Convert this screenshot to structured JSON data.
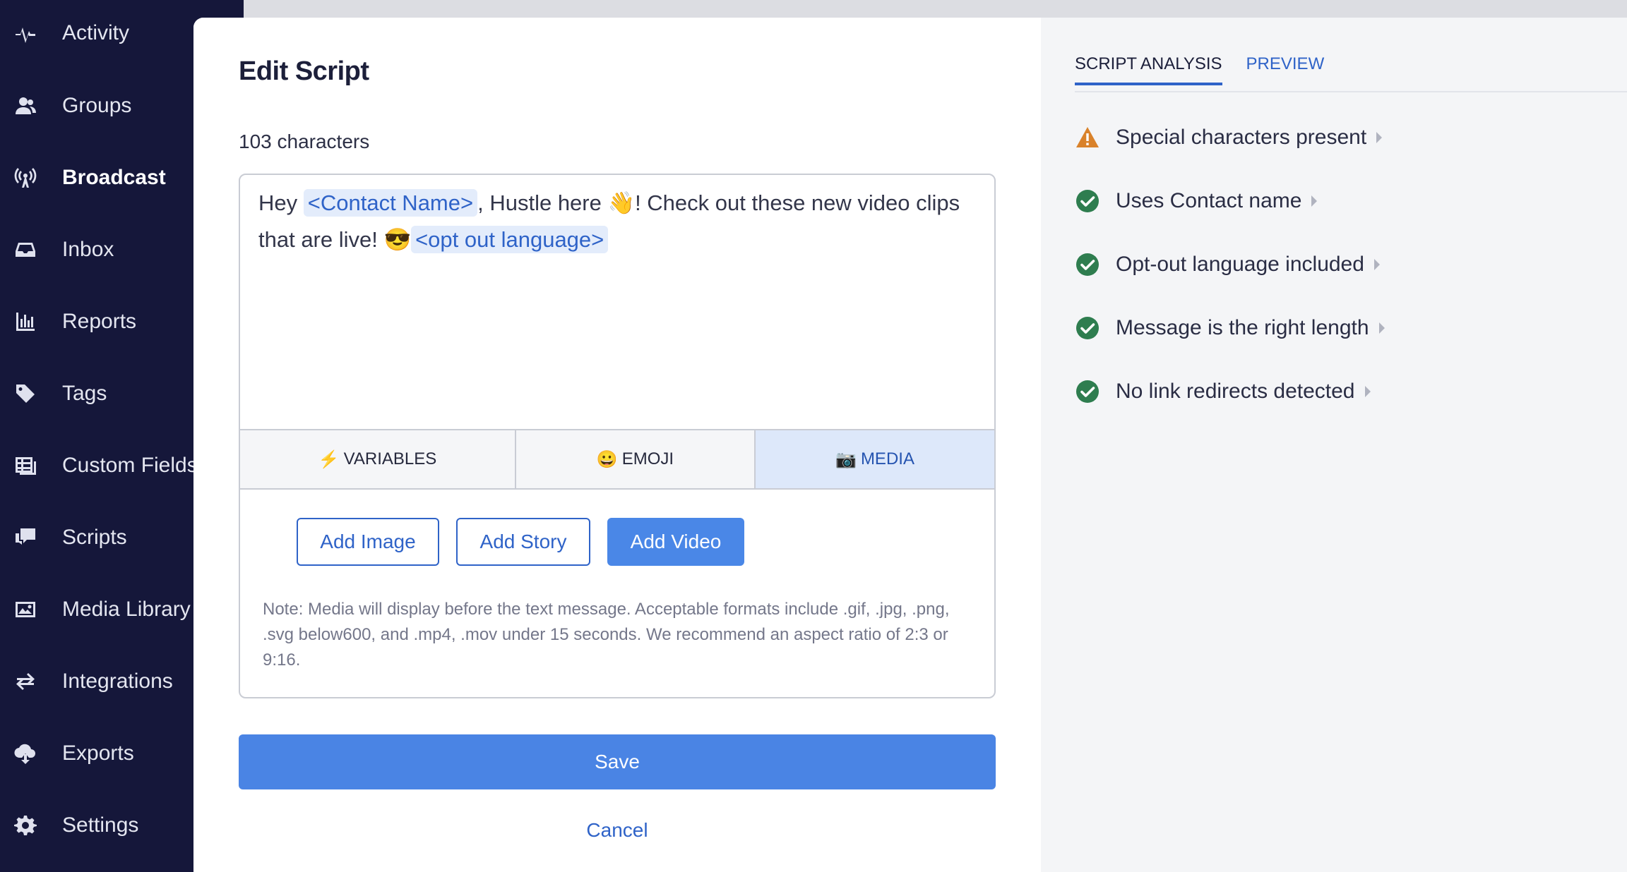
{
  "sidebar": {
    "items": [
      {
        "label": "Activity",
        "icon": "activity-icon"
      },
      {
        "label": "Groups",
        "icon": "groups-icon"
      },
      {
        "label": "Broadcast",
        "icon": "broadcast-icon",
        "active": true
      },
      {
        "label": "Inbox",
        "icon": "inbox-icon"
      },
      {
        "label": "Reports",
        "icon": "reports-icon"
      },
      {
        "label": "Tags",
        "icon": "tag-icon"
      },
      {
        "label": "Custom Fields",
        "icon": "custom-fields-icon"
      },
      {
        "label": "Scripts",
        "icon": "scripts-icon"
      },
      {
        "label": "Media Library",
        "icon": "media-library-icon"
      },
      {
        "label": "Integrations",
        "icon": "integrations-icon"
      },
      {
        "label": "Exports",
        "icon": "exports-icon"
      },
      {
        "label": "Settings",
        "icon": "gear-icon"
      }
    ]
  },
  "modal": {
    "title": "Edit Script",
    "char_count": "103 characters",
    "message": {
      "part1": "Hey ",
      "chip1": "<Contact Name>",
      "part2": ", Hustle here 👋! Check out these new video clips that are live! 😎",
      "chip2": "<opt out language>"
    },
    "tabs": [
      {
        "icon": "⚡",
        "label": "VARIABLES"
      },
      {
        "icon": "😀",
        "label": "EMOJI"
      },
      {
        "icon": "📷",
        "label": "MEDIA",
        "active": true
      }
    ],
    "media_buttons": {
      "add_image": "Add Image",
      "add_story": "Add Story",
      "add_video": "Add Video"
    },
    "note": "Note: Media will display before the text message. Acceptable formats include .gif, .jpg, .png, .svg below600, and .mp4, .mov under 15 seconds. We recommend an aspect ratio of 2:3 or 9:16.",
    "save_label": "Save",
    "cancel_label": "Cancel"
  },
  "analysis": {
    "tabs": [
      {
        "label": "SCRIPT ANALYSIS",
        "active": true
      },
      {
        "label": "PREVIEW"
      }
    ],
    "checks": [
      {
        "label": "Special characters present",
        "status": "warning"
      },
      {
        "label": "Uses Contact name",
        "status": "ok"
      },
      {
        "label": "Opt-out language included",
        "status": "ok"
      },
      {
        "label": "Message is the right length",
        "status": "ok"
      },
      {
        "label": "No link redirects detected",
        "status": "ok"
      }
    ]
  },
  "colors": {
    "sidebar_bg": "#15173a",
    "accent": "#4a84e4",
    "link": "#2f63c8",
    "ok": "#2e7d4f",
    "warning": "#d9822b"
  }
}
